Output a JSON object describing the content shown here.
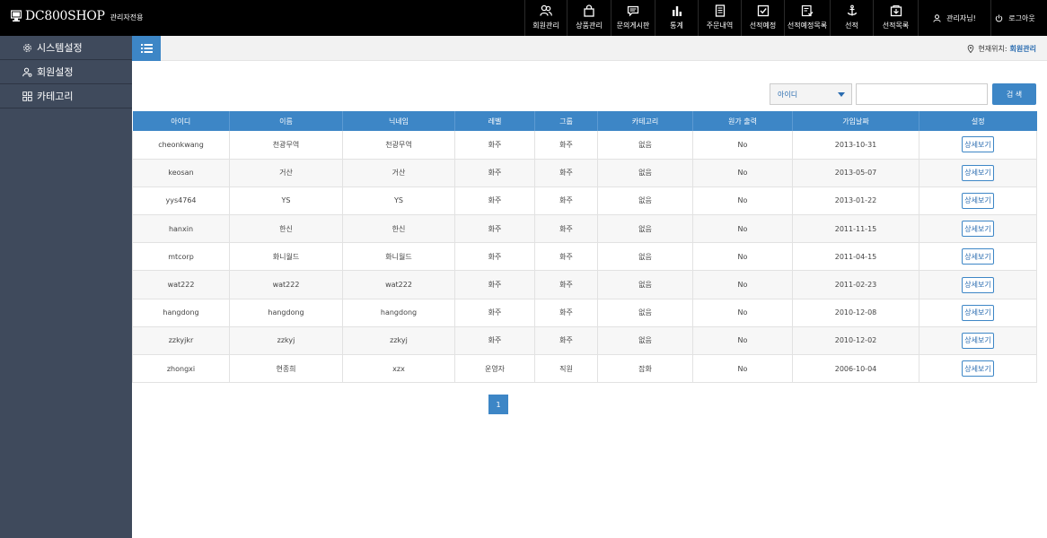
{
  "brand": {
    "name": "DC800SHOP",
    "subtitle": "관리자전용"
  },
  "nav": [
    {
      "label": "회원관리",
      "icon": "users-icon"
    },
    {
      "label": "상품관리",
      "icon": "shopping-bag-icon"
    },
    {
      "label": "문의게시판",
      "icon": "chat-icon"
    },
    {
      "label": "통계",
      "icon": "bar-chart-icon"
    },
    {
      "label": "주문내역",
      "icon": "document-icon"
    },
    {
      "label": "선적예정",
      "icon": "checkbox-icon"
    },
    {
      "label": "선적예정목록",
      "icon": "list-check-icon"
    },
    {
      "label": "선적",
      "icon": "anchor-icon"
    },
    {
      "label": "선적목록",
      "icon": "box-icon"
    }
  ],
  "user": {
    "label": "관리자님!"
  },
  "logout": {
    "label": "로그아웃"
  },
  "sidebar": {
    "items": [
      {
        "label": "시스템설정",
        "icon": "gear-icon"
      },
      {
        "label": "회원설정",
        "icon": "user-gear-icon"
      },
      {
        "label": "카테고리",
        "icon": "grid-icon"
      }
    ]
  },
  "breadcrumb": {
    "prefix": "현재위치:",
    "current": "회원관리"
  },
  "search": {
    "field": "아이디",
    "value": "",
    "button": "검 색"
  },
  "table": {
    "headers": [
      "아이디",
      "이름",
      "닉네임",
      "레벨",
      "그룹",
      "카테고리",
      "원가 출력",
      "가입날짜",
      "설정"
    ],
    "rows": [
      [
        "cheonkwang",
        "천광무역",
        "천광무역",
        "화주",
        "화주",
        "없음",
        "No",
        "2013-10-31",
        "상세보기"
      ],
      [
        "keosan",
        "거산",
        "거산",
        "화주",
        "화주",
        "없음",
        "No",
        "2013-05-07",
        "상세보기"
      ],
      [
        "yys4764",
        "YS",
        "YS",
        "화주",
        "화주",
        "없음",
        "No",
        "2013-01-22",
        "상세보기"
      ],
      [
        "hanxin",
        "한신",
        "한신",
        "화주",
        "화주",
        "없음",
        "No",
        "2011-11-15",
        "상세보기"
      ],
      [
        "mtcorp",
        "화니월드",
        "화니월드",
        "화주",
        "화주",
        "없음",
        "No",
        "2011-04-15",
        "상세보기"
      ],
      [
        "wat222",
        "wat222",
        "wat222",
        "화주",
        "화주",
        "없음",
        "No",
        "2011-02-23",
        "상세보기"
      ],
      [
        "hangdong",
        "hangdong",
        "hangdong",
        "화주",
        "화주",
        "없음",
        "No",
        "2010-12-08",
        "상세보기"
      ],
      [
        "zzkyjkr",
        "zzkyj",
        "zzkyj",
        "화주",
        "화주",
        "없음",
        "No",
        "2010-12-02",
        "상세보기"
      ],
      [
        "zhongxi",
        "현종희",
        "xzx",
        "운영자",
        "직원",
        "잡화",
        "No",
        "2006-10-04",
        "상세보기"
      ]
    ]
  },
  "pagination": {
    "current": "1"
  },
  "colors": {
    "accent": "#3d86c6",
    "topbar": "#000000",
    "sidebar": "#3f4a5c"
  }
}
